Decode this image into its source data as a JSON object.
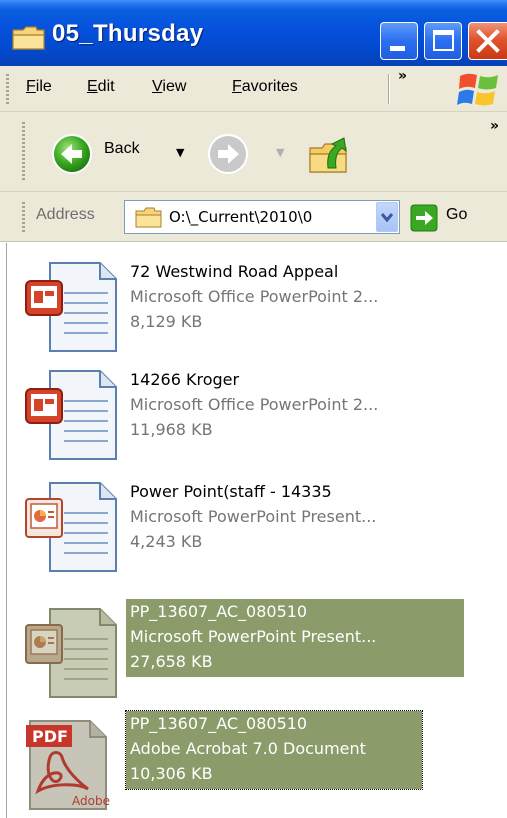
{
  "window": {
    "title": "05_Thursday"
  },
  "menu": {
    "items": [
      "File",
      "Edit",
      "View",
      "Favorites"
    ],
    "overflow": "»"
  },
  "toolbar": {
    "back_label": "Back",
    "overflow": "»"
  },
  "address": {
    "label": "Address",
    "value": "O:\\_Current\\2010\\0",
    "go_label": "Go"
  },
  "files": [
    {
      "name": "72 Westwind Road Appeal",
      "type": "Microsoft Office PowerPoint 2...",
      "size": "8,129 KB",
      "icon": "pptx-document-icon",
      "selected": false
    },
    {
      "name": "14266 Kroger",
      "type": "Microsoft Office PowerPoint 2...",
      "size": "11,968 KB",
      "icon": "pptx-document-icon",
      "selected": false
    },
    {
      "name": "Power Point(staff - 14335",
      "type": "Microsoft PowerPoint Present...",
      "size": "4,243 KB",
      "icon": "ppt-document-icon",
      "selected": false
    },
    {
      "name": "PP_13607_AC_080510",
      "type": "Microsoft PowerPoint Present...",
      "size": "27,658 KB",
      "icon": "ppt-document-icon",
      "selected": true
    },
    {
      "name": "PP_13607_AC_080510",
      "type": "Adobe Acrobat 7.0 Document",
      "size": "10,306 KB",
      "icon": "pdf-document-icon",
      "selected": true
    }
  ],
  "colors": {
    "titlebar": "#0550dc",
    "chrome": "#ece9d8",
    "selection": "#8b9b6a",
    "pptx_accent": "#d6432b",
    "pdf_accent": "#c8362a"
  }
}
